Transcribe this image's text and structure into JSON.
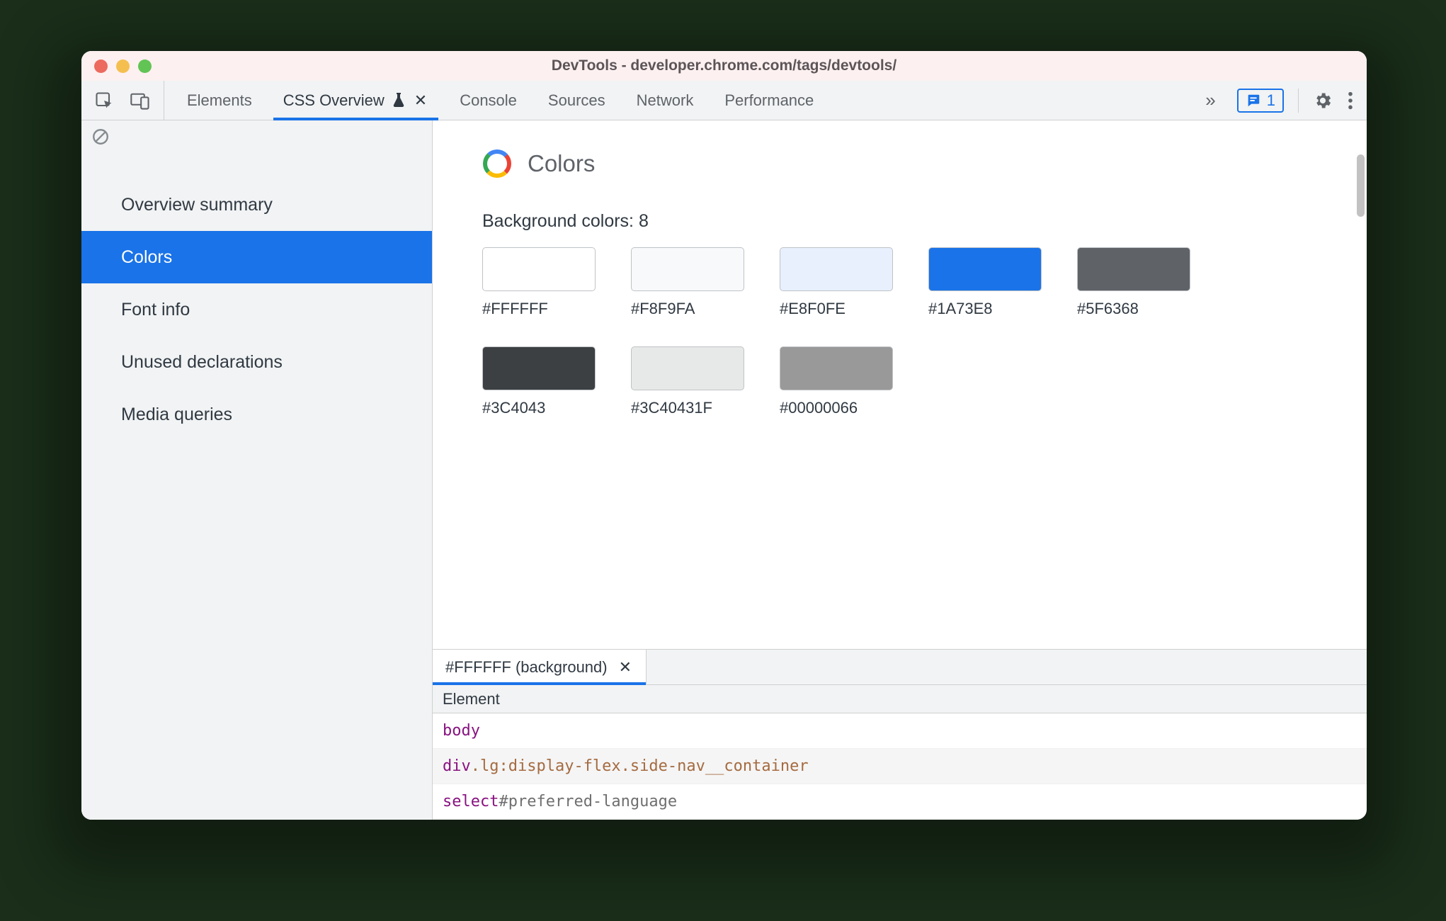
{
  "window": {
    "title": "DevTools - developer.chrome.com/tags/devtools/"
  },
  "tabs": {
    "items": [
      {
        "label": "Elements",
        "active": false
      },
      {
        "label": "CSS Overview",
        "active": true,
        "experimental": true,
        "closable": true
      },
      {
        "label": "Console",
        "active": false
      },
      {
        "label": "Sources",
        "active": false
      },
      {
        "label": "Network",
        "active": false
      },
      {
        "label": "Performance",
        "active": false
      }
    ],
    "issues_count": "1"
  },
  "sidebar": {
    "items": [
      {
        "label": "Overview summary"
      },
      {
        "label": "Colors"
      },
      {
        "label": "Font info"
      },
      {
        "label": "Unused declarations"
      },
      {
        "label": "Media queries"
      }
    ],
    "active_index": 1
  },
  "colors_section": {
    "title": "Colors",
    "subhead": "Background colors: 8",
    "swatches": [
      {
        "label": "#FFFFFF",
        "color": "#FFFFFF"
      },
      {
        "label": "#F8F9FA",
        "color": "#F8F9FA"
      },
      {
        "label": "#E8F0FE",
        "color": "#E8F0FE"
      },
      {
        "label": "#1A73E8",
        "color": "#1A73E8"
      },
      {
        "label": "#5F6368",
        "color": "#5F6368"
      },
      {
        "label": "#3C4043",
        "color": "#3C4043"
      },
      {
        "label": "#3C40431F",
        "color": "rgba(60,64,67,0.12)"
      },
      {
        "label": "#00000066",
        "color": "rgba(0,0,0,0.40)"
      }
    ]
  },
  "details": {
    "tab_label": "#FFFFFF (background)",
    "column_header": "Element",
    "rows": [
      {
        "tag": "body",
        "rest": ""
      },
      {
        "tag": "div",
        "rest_kind": "class",
        "rest": ".lg:display-flex.side-nav__container"
      },
      {
        "tag": "select",
        "rest_kind": "id",
        "rest": "#preferred-language"
      }
    ]
  }
}
